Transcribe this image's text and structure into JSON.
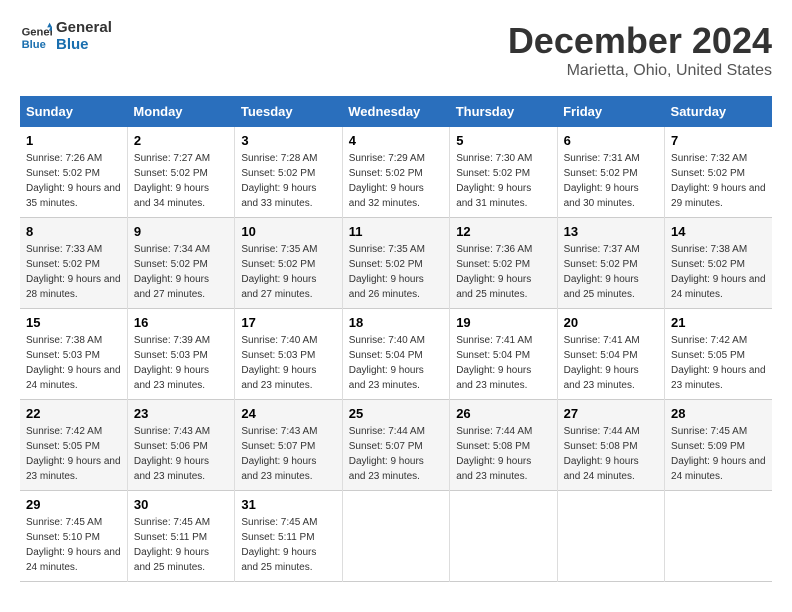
{
  "header": {
    "logo_line1": "General",
    "logo_line2": "Blue",
    "month": "December 2024",
    "location": "Marietta, Ohio, United States"
  },
  "weekdays": [
    "Sunday",
    "Monday",
    "Tuesday",
    "Wednesday",
    "Thursday",
    "Friday",
    "Saturday"
  ],
  "weeks": [
    [
      {
        "day": "1",
        "sunrise": "7:26 AM",
        "sunset": "5:02 PM",
        "daylight": "9 hours and 35 minutes."
      },
      {
        "day": "2",
        "sunrise": "7:27 AM",
        "sunset": "5:02 PM",
        "daylight": "9 hours and 34 minutes."
      },
      {
        "day": "3",
        "sunrise": "7:28 AM",
        "sunset": "5:02 PM",
        "daylight": "9 hours and 33 minutes."
      },
      {
        "day": "4",
        "sunrise": "7:29 AM",
        "sunset": "5:02 PM",
        "daylight": "9 hours and 32 minutes."
      },
      {
        "day": "5",
        "sunrise": "7:30 AM",
        "sunset": "5:02 PM",
        "daylight": "9 hours and 31 minutes."
      },
      {
        "day": "6",
        "sunrise": "7:31 AM",
        "sunset": "5:02 PM",
        "daylight": "9 hours and 30 minutes."
      },
      {
        "day": "7",
        "sunrise": "7:32 AM",
        "sunset": "5:02 PM",
        "daylight": "9 hours and 29 minutes."
      }
    ],
    [
      {
        "day": "8",
        "sunrise": "7:33 AM",
        "sunset": "5:02 PM",
        "daylight": "9 hours and 28 minutes."
      },
      {
        "day": "9",
        "sunrise": "7:34 AM",
        "sunset": "5:02 PM",
        "daylight": "9 hours and 27 minutes."
      },
      {
        "day": "10",
        "sunrise": "7:35 AM",
        "sunset": "5:02 PM",
        "daylight": "9 hours and 27 minutes."
      },
      {
        "day": "11",
        "sunrise": "7:35 AM",
        "sunset": "5:02 PM",
        "daylight": "9 hours and 26 minutes."
      },
      {
        "day": "12",
        "sunrise": "7:36 AM",
        "sunset": "5:02 PM",
        "daylight": "9 hours and 25 minutes."
      },
      {
        "day": "13",
        "sunrise": "7:37 AM",
        "sunset": "5:02 PM",
        "daylight": "9 hours and 25 minutes."
      },
      {
        "day": "14",
        "sunrise": "7:38 AM",
        "sunset": "5:02 PM",
        "daylight": "9 hours and 24 minutes."
      }
    ],
    [
      {
        "day": "15",
        "sunrise": "7:38 AM",
        "sunset": "5:03 PM",
        "daylight": "9 hours and 24 minutes."
      },
      {
        "day": "16",
        "sunrise": "7:39 AM",
        "sunset": "5:03 PM",
        "daylight": "9 hours and 23 minutes."
      },
      {
        "day": "17",
        "sunrise": "7:40 AM",
        "sunset": "5:03 PM",
        "daylight": "9 hours and 23 minutes."
      },
      {
        "day": "18",
        "sunrise": "7:40 AM",
        "sunset": "5:04 PM",
        "daylight": "9 hours and 23 minutes."
      },
      {
        "day": "19",
        "sunrise": "7:41 AM",
        "sunset": "5:04 PM",
        "daylight": "9 hours and 23 minutes."
      },
      {
        "day": "20",
        "sunrise": "7:41 AM",
        "sunset": "5:04 PM",
        "daylight": "9 hours and 23 minutes."
      },
      {
        "day": "21",
        "sunrise": "7:42 AM",
        "sunset": "5:05 PM",
        "daylight": "9 hours and 23 minutes."
      }
    ],
    [
      {
        "day": "22",
        "sunrise": "7:42 AM",
        "sunset": "5:05 PM",
        "daylight": "9 hours and 23 minutes."
      },
      {
        "day": "23",
        "sunrise": "7:43 AM",
        "sunset": "5:06 PM",
        "daylight": "9 hours and 23 minutes."
      },
      {
        "day": "24",
        "sunrise": "7:43 AM",
        "sunset": "5:07 PM",
        "daylight": "9 hours and 23 minutes."
      },
      {
        "day": "25",
        "sunrise": "7:44 AM",
        "sunset": "5:07 PM",
        "daylight": "9 hours and 23 minutes."
      },
      {
        "day": "26",
        "sunrise": "7:44 AM",
        "sunset": "5:08 PM",
        "daylight": "9 hours and 23 minutes."
      },
      {
        "day": "27",
        "sunrise": "7:44 AM",
        "sunset": "5:08 PM",
        "daylight": "9 hours and 24 minutes."
      },
      {
        "day": "28",
        "sunrise": "7:45 AM",
        "sunset": "5:09 PM",
        "daylight": "9 hours and 24 minutes."
      }
    ],
    [
      {
        "day": "29",
        "sunrise": "7:45 AM",
        "sunset": "5:10 PM",
        "daylight": "9 hours and 24 minutes."
      },
      {
        "day": "30",
        "sunrise": "7:45 AM",
        "sunset": "5:11 PM",
        "daylight": "9 hours and 25 minutes."
      },
      {
        "day": "31",
        "sunrise": "7:45 AM",
        "sunset": "5:11 PM",
        "daylight": "9 hours and 25 minutes."
      },
      null,
      null,
      null,
      null
    ]
  ],
  "labels": {
    "sunrise": "Sunrise:",
    "sunset": "Sunset:",
    "daylight": "Daylight:"
  }
}
